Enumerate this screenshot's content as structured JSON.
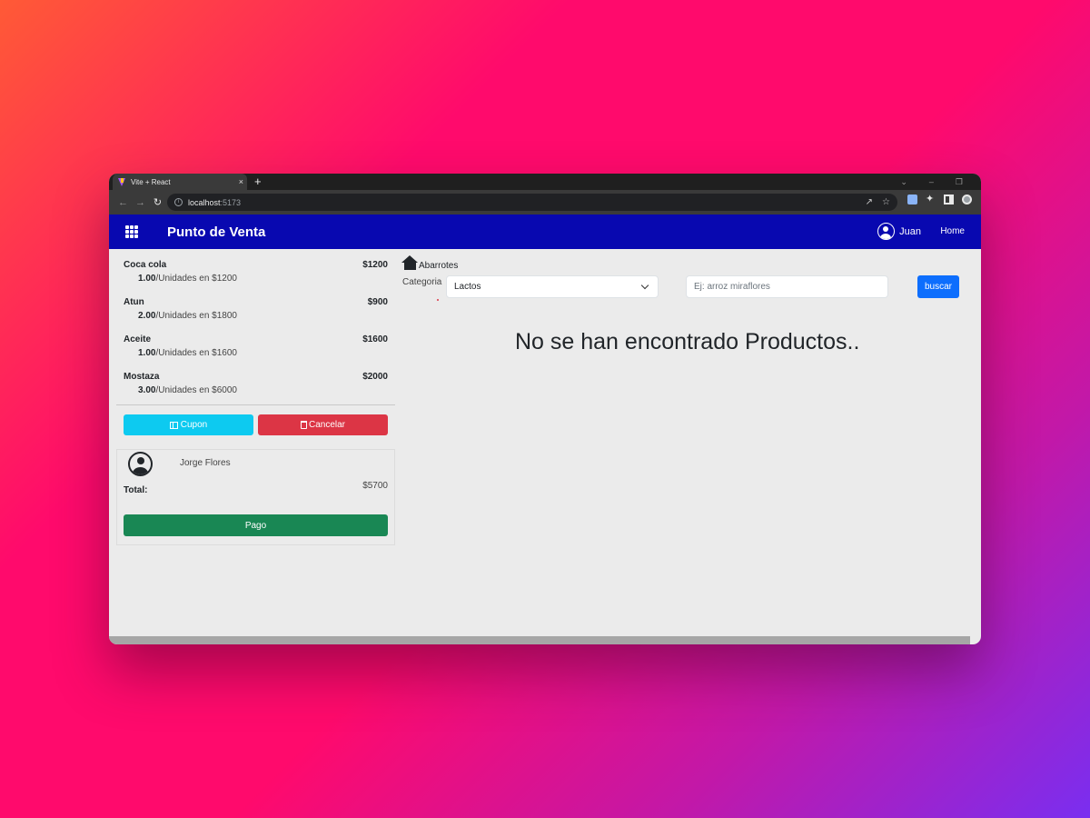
{
  "browser": {
    "tab_title": "Vite + React",
    "tab_close": "×",
    "new_tab": "+",
    "url_host": "localhost",
    "url_port": ":5173"
  },
  "navbar": {
    "brand": "Punto de Venta",
    "user_name": "Juan",
    "home_link": "Home"
  },
  "cart": {
    "items": [
      {
        "name": "Coca cola",
        "price": "$1200",
        "qty": "1.00",
        "unit_text": "/Unidades en $1200"
      },
      {
        "name": "Atun",
        "price": "$900",
        "qty": "2.00",
        "unit_text": "/Unidades en $1800"
      },
      {
        "name": "Aceite",
        "price": "$1600",
        "qty": "1.00",
        "unit_text": "/Unidades en $1600"
      },
      {
        "name": "Mostaza",
        "price": "$2000",
        "qty": "3.00",
        "unit_text": "/Unidades en $6000"
      }
    ],
    "cupon_label": "Cupon",
    "cancel_label": "Cancelar",
    "client_name": "Jorge Flores",
    "total_label": "Total:",
    "total_value": "$5700",
    "pay_label": "Pago"
  },
  "products": {
    "breadcrumb": "Abarrotes",
    "category_label": "Categoria",
    "category_selected": "Lactos",
    "search_placeholder": "Ej: arroz miraflores",
    "search_button": "buscar",
    "empty_message": "No se han encontrado Productos.."
  },
  "colors": {
    "navbar": "#0808b0",
    "cupon": "#0dcaf0",
    "cancel": "#dc3545",
    "pay": "#198754",
    "search_button": "#0d6efd"
  }
}
